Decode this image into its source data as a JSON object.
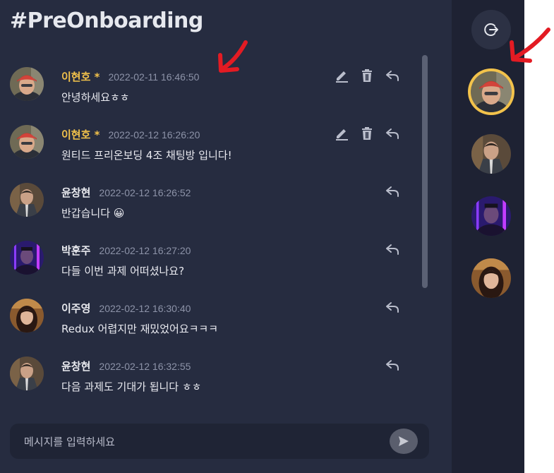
{
  "channel": {
    "title": "#PreOnboarding"
  },
  "colors": {
    "accent": "#f2c24b",
    "annotation": "#e31b23",
    "chat_bg": "#262c40",
    "sidebar_bg": "#1e2233"
  },
  "messages": [
    {
      "author": "이현호 *",
      "time": "2022-02-11 16:46:50",
      "text": "안녕하세요ㅎㅎ",
      "is_me": true,
      "avatar": "avatar-leehyunho"
    },
    {
      "author": "이현호 *",
      "time": "2022-02-12 16:26:20",
      "text": "원티드 프리온보딩 4조 채팅방 입니다!",
      "is_me": true,
      "avatar": "avatar-leehyunho"
    },
    {
      "author": "윤창현",
      "time": "2022-02-12 16:26:52",
      "text": "반갑습니다 😀",
      "is_me": false,
      "avatar": "avatar-yoonchanghyun"
    },
    {
      "author": "박훈주",
      "time": "2022-02-12 16:27:20",
      "text": "다들 이번 과제 어떠셨나요?",
      "is_me": false,
      "avatar": "avatar-parkhoonju"
    },
    {
      "author": "이주영",
      "time": "2022-02-12 16:30:40",
      "text": "Redux 어렵지만 재밌었어요ㅋㅋㅋ",
      "is_me": false,
      "avatar": "avatar-leejuyoung"
    },
    {
      "author": "윤창현",
      "time": "2022-02-12 16:32:55",
      "text": "다음 과제도 기대가 됩니다 ㅎㅎ",
      "is_me": false,
      "avatar": "avatar-yoonchanghyun"
    }
  ],
  "composer": {
    "placeholder": "메시지를 입력하세요"
  },
  "icons": {
    "exit": "exit-icon",
    "send": "send-icon",
    "edit": "edit-icon",
    "delete": "trash-icon",
    "reply": "reply-icon"
  }
}
